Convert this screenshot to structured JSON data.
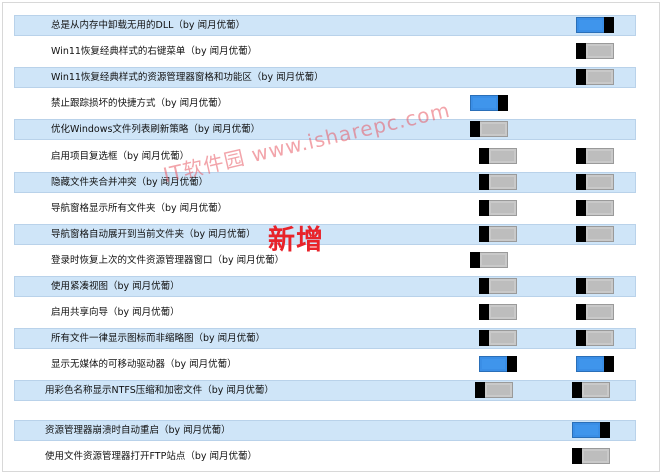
{
  "settings": [
    {
      "label": "总是从内存中卸载无用的DLL（by 闻月优葡）",
      "style": "shaded",
      "toggles": [
        {
          "col": "right",
          "on": true
        }
      ]
    },
    {
      "label": "Win11恢复经典样式的右键菜单（by 闻月优葡）",
      "style": "plain",
      "toggles": [
        {
          "col": "right",
          "on": false
        }
      ]
    },
    {
      "label": "Win11恢复经典样式的资源管理器窗格和功能区（by 闻月优葡）",
      "style": "shaded",
      "toggles": [
        {
          "col": "right",
          "on": false
        }
      ]
    },
    {
      "label": "禁止跟踪损坏的快捷方式（by 闻月优葡）",
      "style": "plain",
      "toggles": [
        {
          "col": "mid",
          "on": true
        }
      ]
    },
    {
      "label": "优化Windows文件列表刷新策略（by 闻月优葡）",
      "style": "shaded",
      "toggles": [
        {
          "col": "mid",
          "on": false
        }
      ]
    },
    {
      "label": "启用项目复选框（by 闻月优葡）",
      "style": "plain",
      "toggles": [
        {
          "col": "mid2",
          "on": false
        },
        {
          "col": "right",
          "on": false
        }
      ]
    },
    {
      "label": "隐藏文件夹合并冲突（by 闻月优葡）",
      "style": "shaded",
      "toggles": [
        {
          "col": "mid2",
          "on": false
        },
        {
          "col": "right",
          "on": false
        }
      ]
    },
    {
      "label": "导航窗格显示所有文件夹（by 闻月优葡）",
      "style": "plain",
      "toggles": [
        {
          "col": "mid2",
          "on": false
        },
        {
          "col": "right",
          "on": false
        }
      ]
    },
    {
      "label": "导航窗格自动展开到当前文件夹（by 闻月优葡）",
      "style": "shaded",
      "toggles": [
        {
          "col": "mid2",
          "on": false
        },
        {
          "col": "right",
          "on": false
        }
      ]
    },
    {
      "label": "登录时恢复上次的文件资源管理器窗口（by 闻月优葡）",
      "style": "plain",
      "toggles": [
        {
          "col": "mid",
          "on": false
        }
      ]
    },
    {
      "label": "使用紧凑视图（by 闻月优葡）",
      "style": "shaded",
      "toggles": [
        {
          "col": "mid2",
          "on": false
        },
        {
          "col": "right",
          "on": false
        }
      ]
    },
    {
      "label": "启用共享向导（by 闻月优葡）",
      "style": "plain",
      "toggles": [
        {
          "col": "mid2",
          "on": false
        },
        {
          "col": "right",
          "on": false
        }
      ]
    },
    {
      "label": "所有文件一律显示图标而非缩略图（by 闻月优葡）",
      "style": "shaded",
      "toggles": [
        {
          "col": "mid2",
          "on": false
        },
        {
          "col": "right",
          "on": false
        }
      ]
    },
    {
      "label": "显示无媒体的可移动驱动器（by 闻月优葡）",
      "style": "plain",
      "toggles": [
        {
          "col": "mid2",
          "on": true
        },
        {
          "col": "right",
          "on": true
        }
      ]
    },
    {
      "label": "用彩色名称显示NTFS压缩和加密文件（by 闻月优葡）",
      "style": "shaded",
      "toggles": [
        {
          "col": "mid3",
          "on": false
        },
        {
          "col": "right2",
          "on": false
        }
      ]
    },
    {
      "label": "资源管理器崩溃时自动重启（by 闻月优葡）",
      "style": "shaded",
      "toggles": [
        {
          "col": "right2",
          "on": true
        }
      ]
    },
    {
      "label": "使用文件资源管理器打开FTP站点（by 闻月优葡）",
      "style": "plain",
      "toggles": [
        {
          "col": "right2",
          "on": false
        }
      ]
    }
  ],
  "badge": "新增",
  "watermark": "IT软件园 www.isharepc.com"
}
